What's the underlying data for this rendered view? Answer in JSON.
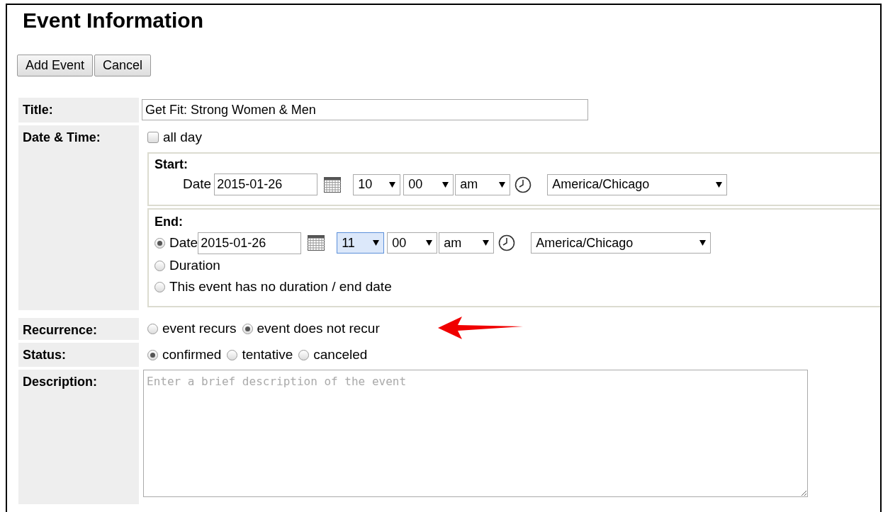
{
  "heading": "Event Information",
  "buttons": [
    "Add Event",
    "Cancel"
  ],
  "title_row": {
    "label": "Title:",
    "value": "Get Fit: Strong Women & Men"
  },
  "date_time": {
    "label": "Date & Time:",
    "all_day": {
      "label": "all day",
      "checked": false
    },
    "start": {
      "heading": "Start:",
      "date_label": "Date",
      "date": "2015-01-26",
      "hour": {
        "value": "10",
        "focused": false
      },
      "minute": "00",
      "ampm": "am",
      "timezone": "America/Chicago"
    },
    "end": {
      "heading": "End:",
      "options": [
        {
          "kind": "date",
          "label": "Date",
          "selected": true,
          "date": "2015-01-26",
          "hour": {
            "value": "11",
            "focused": true
          },
          "minute": "00",
          "ampm": "am",
          "timezone": "America/Chicago"
        },
        {
          "kind": "plain",
          "label": "Duration",
          "selected": false
        },
        {
          "kind": "plain",
          "label": "This event has no duration / end date",
          "selected": false
        }
      ]
    }
  },
  "recurrence": {
    "label": "Recurrence:",
    "options": [
      {
        "label": "event recurs",
        "selected": false
      },
      {
        "label": "event does not recur",
        "selected": true
      }
    ]
  },
  "status": {
    "label": "Status:",
    "options": [
      {
        "label": "confirmed",
        "selected": true
      },
      {
        "label": "tentative",
        "selected": false
      },
      {
        "label": "canceled",
        "selected": false
      }
    ]
  },
  "description": {
    "label": "Description:",
    "placeholder": "Enter a brief description of the event"
  }
}
